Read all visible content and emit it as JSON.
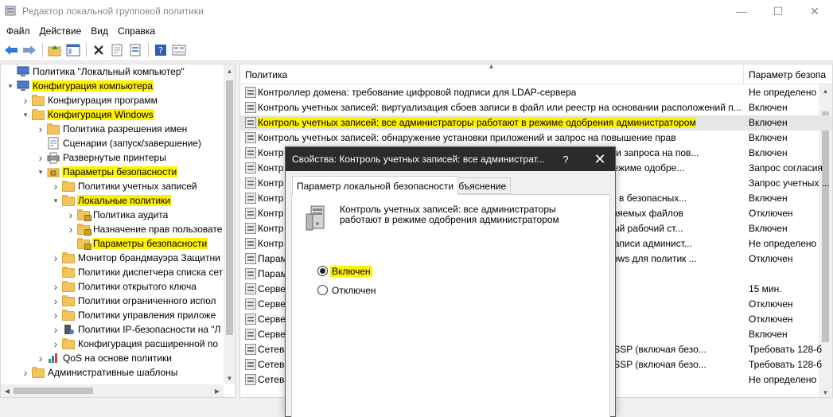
{
  "window": {
    "title": "Редактор локальной групповой политики",
    "minimize": "—",
    "maximize": "☐",
    "close": "✕"
  },
  "menu": [
    "Файл",
    "Действие",
    "Вид",
    "Справка"
  ],
  "toolbar": {
    "icons": [
      "back-arrow-icon",
      "forward-arrow-icon",
      "up-folder-icon",
      "show-hide-tree-icon",
      "delete-icon",
      "properties-icon",
      "export-list-icon",
      "help-icon",
      "filter-icon"
    ]
  },
  "tree": {
    "items": [
      {
        "label": "Политика \"Локальный компьютер\"",
        "level": 0,
        "chevron": "",
        "icon": "computer-icon",
        "highlight": false
      },
      {
        "label": "Конфигурация компьютера",
        "level": 0,
        "chevron": "v",
        "icon": "computer-icon",
        "highlight": true
      },
      {
        "label": "Конфигурация программ",
        "level": 1,
        "chevron": ">",
        "icon": "folder-icon",
        "highlight": false
      },
      {
        "label": "Конфигурация Windows",
        "level": 1,
        "chevron": "v",
        "icon": "folder-icon",
        "highlight": true
      },
      {
        "label": "Политика разрешения имен",
        "level": 2,
        "chevron": ">",
        "icon": "folder-icon",
        "highlight": false
      },
      {
        "label": "Сценарии (запуск/завершение)",
        "level": 2,
        "chevron": "",
        "icon": "script-icon",
        "highlight": false
      },
      {
        "label": "Развернутые принтеры",
        "level": 2,
        "chevron": ">",
        "icon": "printer-icon",
        "highlight": false
      },
      {
        "label": "Параметры безопасности",
        "level": 2,
        "chevron": "v",
        "icon": "security-icon",
        "highlight": true
      },
      {
        "label": "Политики учетных записей",
        "level": 3,
        "chevron": ">",
        "icon": "folder-icon",
        "highlight": false
      },
      {
        "label": "Локальные политики",
        "level": 3,
        "chevron": "v",
        "icon": "folder-icon",
        "highlight": true
      },
      {
        "label": "Политика аудита",
        "level": 4,
        "chevron": ">",
        "icon": "lock-folder-icon",
        "highlight": false
      },
      {
        "label": "Назначение прав пользовате",
        "level": 4,
        "chevron": ">",
        "icon": "lock-folder-icon",
        "highlight": false
      },
      {
        "label": "Параметры безопасности",
        "level": 4,
        "chevron": "",
        "icon": "lock-folder-icon",
        "highlight": true
      },
      {
        "label": "Монитор брандмауэра Защитни",
        "level": 3,
        "chevron": ">",
        "icon": "folder-icon",
        "highlight": false
      },
      {
        "label": "Политики диспетчера списка сет",
        "level": 3,
        "chevron": "",
        "icon": "folder-icon",
        "highlight": false
      },
      {
        "label": "Политики открытого ключа",
        "level": 3,
        "chevron": ">",
        "icon": "folder-icon",
        "highlight": false
      },
      {
        "label": "Политики ограниченного испол",
        "level": 3,
        "chevron": ">",
        "icon": "folder-icon",
        "highlight": false
      },
      {
        "label": "Политики управления приложе",
        "level": 3,
        "chevron": ">",
        "icon": "folder-icon",
        "highlight": false
      },
      {
        "label": "Политики IP-безопасности на \"Л",
        "level": 3,
        "chevron": ">",
        "icon": "ipsec-icon",
        "highlight": false
      },
      {
        "label": "Конфигурация расширенной по",
        "level": 3,
        "chevron": ">",
        "icon": "folder-icon",
        "highlight": false
      },
      {
        "label": "QoS на основе политики",
        "level": 2,
        "chevron": ">",
        "icon": "chart-icon",
        "highlight": false
      },
      {
        "label": "Административные шаблоны",
        "level": 1,
        "chevron": ">",
        "icon": "folder-icon",
        "highlight": false
      }
    ]
  },
  "list": {
    "columns": {
      "policy": "Политика",
      "setting": "Параметр безопа"
    },
    "rows": [
      {
        "policy": "Контроллер домена: требование цифровой подписи для LDAP-сервера",
        "setting": "Не определено",
        "selected": false,
        "highlight": false
      },
      {
        "policy": "Контроль учетных записей: виртуализация сбоев записи в файл или реестр на основании расположений п...",
        "setting": "Включен",
        "selected": false,
        "highlight": false
      },
      {
        "policy": "Контроль учетных записей: все администраторы работают в режиме одобрения администратором",
        "setting": "Включен",
        "selected": true,
        "highlight": true
      },
      {
        "policy": "Контроль учетных записей: обнаружение установки приложений и запрос на повышение прав",
        "setting": "Включен",
        "selected": false,
        "highlight": false
      },
      {
        "policy": "Контр",
        "policy_tail": "ыполнении запроса на пов...",
        "setting": "Включен",
        "selected": false,
        "highlight": false
      },
      {
        "policy": "Контр",
        "policy_tail": "торов в режиме одобре...",
        "setting": "Запрос согласия",
        "selected": false,
        "highlight": false
      },
      {
        "policy": "Контр",
        "policy_tail": "ователей",
        "setting": "Запрос учетных ...",
        "selected": false,
        "highlight": false
      },
      {
        "policy": "Контр",
        "policy_tail": "установке в безопасных...",
        "setting": "Включен",
        "selected": false,
        "highlight": false
      },
      {
        "policy": "Контр",
        "policy_tail": "ых исполняемых файлов",
        "setting": "Отключен",
        "selected": false,
        "highlight": false
      },
      {
        "policy": "Контр",
        "policy_tail": "безопасный рабочий ст...",
        "setting": "Включен",
        "selected": false,
        "highlight": false
      },
      {
        "policy": "Контр",
        "policy_tail": "учетной записи админист...",
        "setting": "Не определено",
        "selected": false,
        "highlight": false
      },
      {
        "policy": "Парам",
        "policy_tail": "лов Windows для политик ...",
        "setting": "Отключен",
        "selected": false,
        "highlight": false
      },
      {
        "policy": "Парам",
        "policy_tail": "",
        "setting": "",
        "selected": false,
        "highlight": false
      },
      {
        "policy": "Серве",
        "policy_tail": "",
        "setting": "15 мин.",
        "selected": false,
        "highlight": false
      },
      {
        "policy": "Серве",
        "policy_tail": "",
        "setting": "Отключен",
        "selected": false,
        "highlight": false
      },
      {
        "policy": "Серве",
        "policy_tail": "",
        "setting": "Отключен",
        "selected": false,
        "highlight": false
      },
      {
        "policy": "Серве",
        "policy_tail": "ода",
        "setting": "Включен",
        "selected": false,
        "highlight": false
      },
      {
        "policy": "Сетева",
        "policy_tail": "ве NTLM SSP (включая безо...",
        "setting": "Требовать 128-б",
        "selected": false,
        "highlight": false
      },
      {
        "policy": "Сетева",
        "policy_tail": "ве NTLM SSP (включая безо...",
        "setting": "Требовать 128-б",
        "selected": false,
        "highlight": false
      },
      {
        "policy": "Сетева",
        "policy_tail": "",
        "setting": "Не определено",
        "selected": false,
        "highlight": false
      }
    ]
  },
  "dialog": {
    "title": "Свойства: Контроль учетных записей: все администрат...",
    "help": "?",
    "close": "✕",
    "tabs": [
      "Параметр локальной безопасности",
      "Объяснение"
    ],
    "description": "Контроль учетных записей: все администраторы работают в режиме одобрения администратором",
    "options": [
      {
        "label": "Включен",
        "checked": true,
        "highlight": true
      },
      {
        "label": "Отключен",
        "checked": false,
        "highlight": false
      }
    ]
  },
  "colors": {
    "highlight": "#fff200",
    "selected_row": "#e6e6e6",
    "dialog_title_bg": "#2b2b2b"
  }
}
